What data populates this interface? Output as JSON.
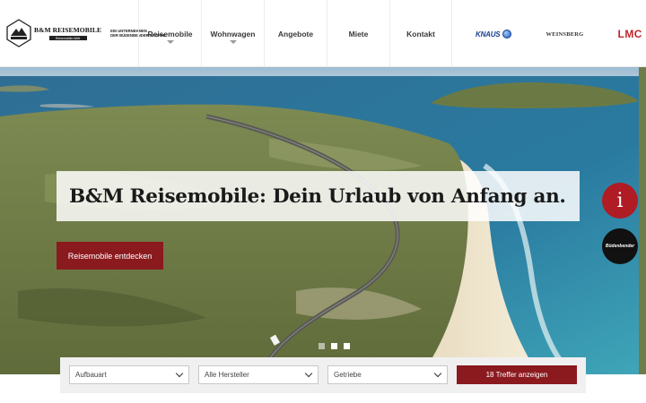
{
  "header": {
    "logo": {
      "name": "B&M REISEMOBILE",
      "bar_text": "Reisemobile-Welt",
      "tagline_line1": "EIN UNTERNEHMEN",
      "tagline_line2": "DER BÜDENBENDER GRUPPE"
    },
    "nav": [
      {
        "label": "Reisemobile",
        "has_dropdown": true
      },
      {
        "label": "Wohnwagen",
        "has_dropdown": true
      },
      {
        "label": "Angebote",
        "has_dropdown": false
      },
      {
        "label": "Miete",
        "has_dropdown": false
      },
      {
        "label": "Kontakt",
        "has_dropdown": false
      }
    ],
    "brands": {
      "knaus": "KNAUS",
      "weinsberg": "WEINSBERG",
      "lmc": "LMC"
    }
  },
  "hero": {
    "headline": "B&M Reisemobile: Dein Urlaub von Anfang an.",
    "cta_label": "Reisemobile entdecken",
    "info_icon": "i",
    "partner_label": "Büdenbender",
    "slides": 3,
    "active_slide": 1
  },
  "filter": {
    "aufbauart": "Aufbauart",
    "hersteller": "Alle Hersteller",
    "getriebe": "Getriebe",
    "submit_label": "18 Treffer anzeigen"
  },
  "colors": {
    "accent": "#8b1a1f",
    "info_red": "#b01c24"
  }
}
